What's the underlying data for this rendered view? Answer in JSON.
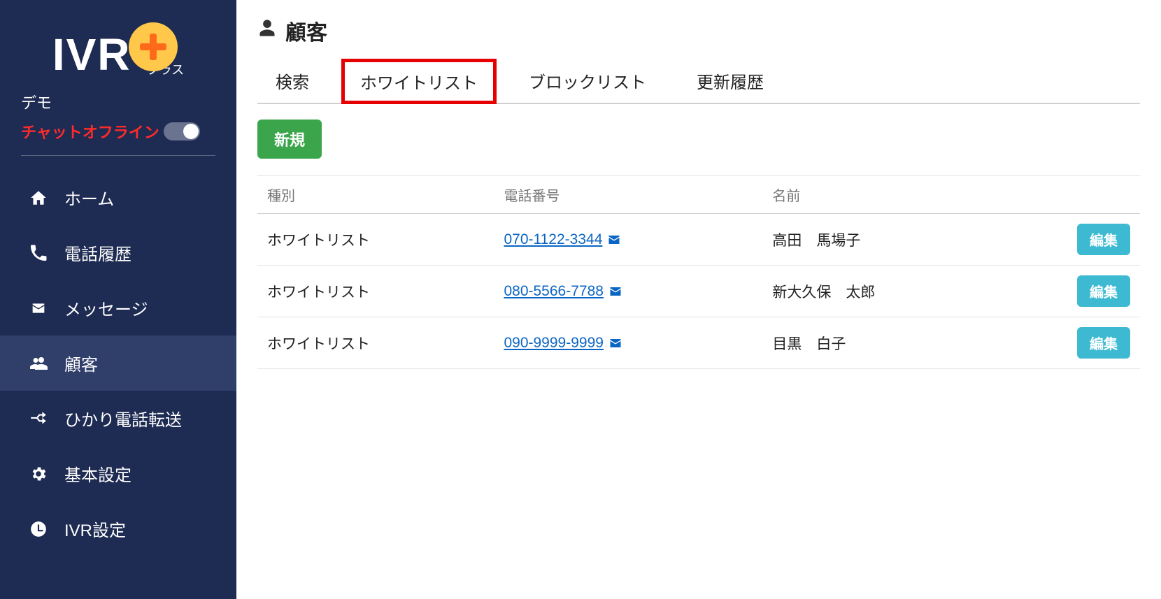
{
  "sidebar": {
    "logo_text": "IVR",
    "logo_sub": "プラス",
    "demo_label": "デモ",
    "chat_offline": "チャットオフライン",
    "items": [
      {
        "key": "home",
        "label": "ホーム"
      },
      {
        "key": "calls",
        "label": "電話履歴"
      },
      {
        "key": "messages",
        "label": "メッセージ"
      },
      {
        "key": "customers",
        "label": "顧客"
      },
      {
        "key": "forward",
        "label": "ひかり電話転送"
      },
      {
        "key": "settings",
        "label": "基本設定"
      },
      {
        "key": "ivr",
        "label": "IVR設定"
      }
    ]
  },
  "page": {
    "title": "顧客",
    "tabs": [
      {
        "key": "search",
        "label": "検索"
      },
      {
        "key": "whitelist",
        "label": "ホワイトリスト"
      },
      {
        "key": "blocklist",
        "label": "ブロックリスト"
      },
      {
        "key": "history",
        "label": "更新履歴"
      }
    ],
    "new_button": "新規",
    "columns": {
      "type": "種別",
      "phone": "電話番号",
      "name": "名前"
    },
    "edit_label": "編集",
    "rows": [
      {
        "type": "ホワイトリスト",
        "phone": "070-1122-3344",
        "name": "高田　馬場子"
      },
      {
        "type": "ホワイトリスト",
        "phone": "080-5566-7788",
        "name": "新大久保　太郎"
      },
      {
        "type": "ホワイトリスト",
        "phone": "090-9999-9999",
        "name": "目黒　白子"
      }
    ]
  }
}
